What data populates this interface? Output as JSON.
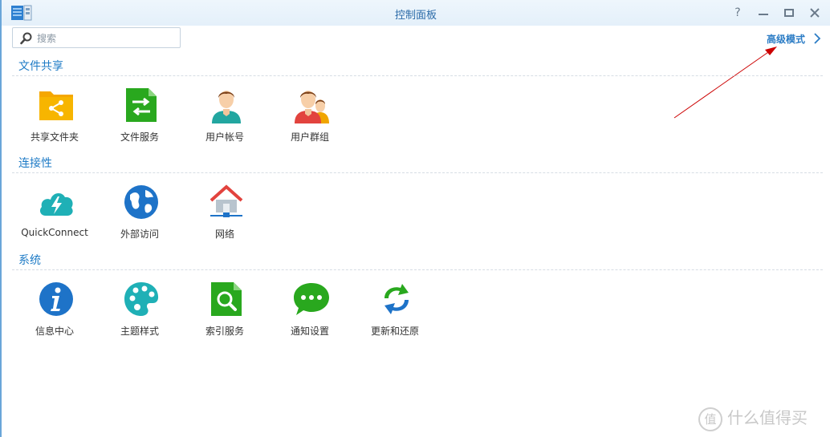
{
  "window": {
    "title": "控制面板",
    "help_icon": "question-icon",
    "minimize_icon": "minimize-icon",
    "maximize_icon": "maximize-icon",
    "close_icon": "close-icon"
  },
  "search": {
    "placeholder": "搜索",
    "value": ""
  },
  "advanced_mode": {
    "label": "高级模式"
  },
  "sections": [
    {
      "title": "文件共享",
      "items": [
        {
          "label": "共享文件夹",
          "icon": "shared-folder-icon"
        },
        {
          "label": "文件服务",
          "icon": "file-services-icon"
        },
        {
          "label": "用户帐号",
          "icon": "user-icon"
        },
        {
          "label": "用户群组",
          "icon": "user-group-icon"
        }
      ]
    },
    {
      "title": "连接性",
      "items": [
        {
          "label": "QuickConnect",
          "icon": "quickconnect-icon"
        },
        {
          "label": "外部访问",
          "icon": "external-access-globe-icon"
        },
        {
          "label": "网络",
          "icon": "network-house-icon"
        }
      ]
    },
    {
      "title": "系统",
      "items": [
        {
          "label": "信息中心",
          "icon": "info-center-icon"
        },
        {
          "label": "主题样式",
          "icon": "theme-palette-icon"
        },
        {
          "label": "索引服务",
          "icon": "indexing-service-icon"
        },
        {
          "label": "通知设置",
          "icon": "notification-chat-icon"
        },
        {
          "label": "更新和还原",
          "icon": "update-restore-icon"
        }
      ]
    }
  ],
  "watermark": {
    "text": "什么值得买",
    "badge": "值"
  },
  "colors": {
    "accent": "#1e7bc6",
    "arrow": "#cc0000"
  }
}
